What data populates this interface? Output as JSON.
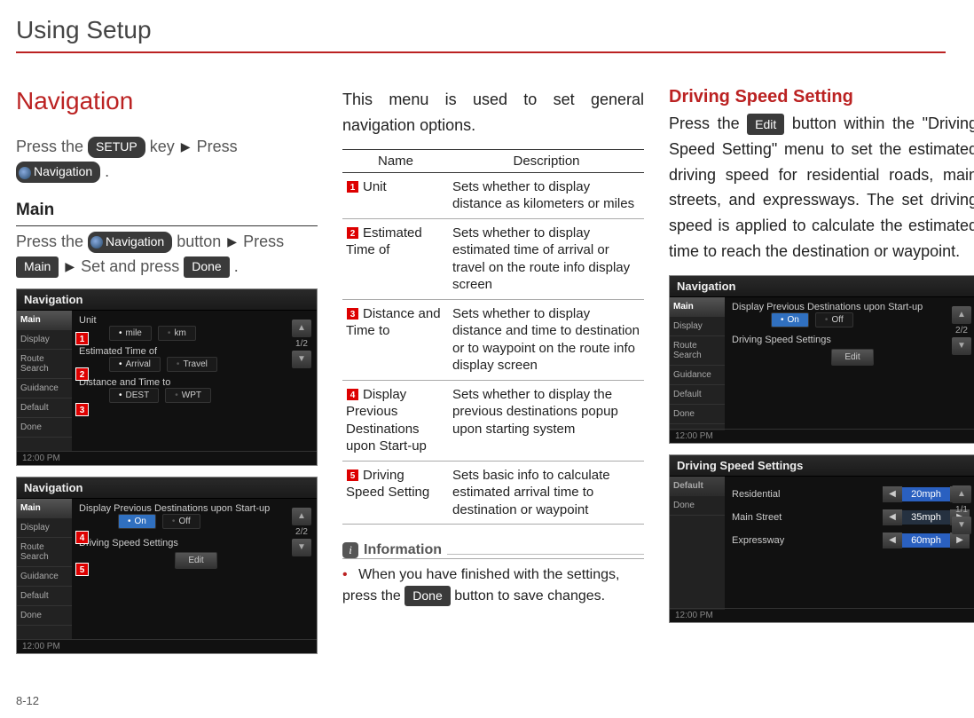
{
  "page_title": "Using Setup",
  "page_number": "8-12",
  "pill": {
    "setup": "SETUP",
    "navigation": "Navigation",
    "main": "Main",
    "done": "Done",
    "edit": "Edit"
  },
  "col1": {
    "heading": "Navigation",
    "line1_a": "Press the ",
    "line1_b": " key",
    "line1_c": " Press",
    "period": " .",
    "sub_main": "Main",
    "main_line_a": "Press the ",
    "main_line_b": " button ",
    "main_line_c": " Press",
    "main_line2_a": " ",
    "main_line2_b": " Set and press ",
    "main_line2_c": " ."
  },
  "shot1": {
    "title": "Navigation",
    "side": [
      "Main",
      "Display",
      "Route Search",
      "Guidance",
      "Default",
      "Done"
    ],
    "rows": {
      "unit_label": "Unit",
      "unit_opts": [
        "mile",
        "km"
      ],
      "est_label": "Estimated Time of",
      "est_opts": [
        "Arrival",
        "Travel"
      ],
      "dist_label": "Distance and Time to",
      "dist_opts": [
        "DEST",
        "WPT"
      ]
    },
    "pager": "1/2",
    "time": "12:00 PM"
  },
  "shot2": {
    "title": "Navigation",
    "side": [
      "Main",
      "Display",
      "Route Search",
      "Guidance",
      "Default",
      "Done"
    ],
    "rows": {
      "prev_label": "Display Previous Destinations upon Start-up",
      "prev_opts": [
        "On",
        "Off"
      ],
      "speed_label": "Driving Speed Settings",
      "speed_btn": "Edit"
    },
    "pager": "2/2",
    "time": "12:00 PM"
  },
  "col2": {
    "intro": "This menu is used to set general navigation options.",
    "th_name": "Name",
    "th_desc": "Description",
    "rows": [
      {
        "num": "1",
        "name": "Unit",
        "desc": "Sets whether to display distance as kilometers or miles"
      },
      {
        "num": "2",
        "name": "Estimated Time of",
        "desc": "Sets whether to display estimated time of arrival or travel on the route info display screen"
      },
      {
        "num": "3",
        "name": "Distance and Time to",
        "desc": "Sets whether to display distance and time to destination or to waypoint on the route info display screen"
      },
      {
        "num": "4",
        "name": "Display Previous Destinations upon Start-up",
        "desc": "Sets whether to display the previous destinations popup upon starting system"
      },
      {
        "num": "5",
        "name": "Driving Speed Setting",
        "desc": "Sets basic info to calculate estimated arrival time to destination or waypoint"
      }
    ],
    "info_label": "Information",
    "info_text_a": "When you have finished with the settings, press the ",
    "info_text_b": " button to save changes."
  },
  "col3": {
    "heading": "Driving Speed Setting",
    "body_a": "Press the ",
    "body_b": " button within the \"Driving Speed Setting\" menu to set the estimated driving speed for residential roads, main streets, and expressways. The set driving speed is applied to calculate the estimated time to reach the destination or waypoint."
  },
  "shot3": {
    "title": "Navigation",
    "side": [
      "Main",
      "Display",
      "Route Search",
      "Guidance",
      "Default",
      "Done"
    ],
    "prev_label": "Display Previous Destinations upon Start-up",
    "prev_opts": [
      "On",
      "Off"
    ],
    "speed_label": "Driving Speed Settings",
    "speed_btn": "Edit",
    "pager": "2/2",
    "time": "12:00 PM"
  },
  "shot4": {
    "title": "Driving Speed Settings",
    "side": [
      "Default",
      "Done"
    ],
    "rows": [
      {
        "label": "Residential",
        "val": "20mph"
      },
      {
        "label": "Main Street",
        "val": "35mph"
      },
      {
        "label": "Expressway",
        "val": "60mph"
      }
    ],
    "pager": "1/1",
    "time": "12:00 PM"
  }
}
